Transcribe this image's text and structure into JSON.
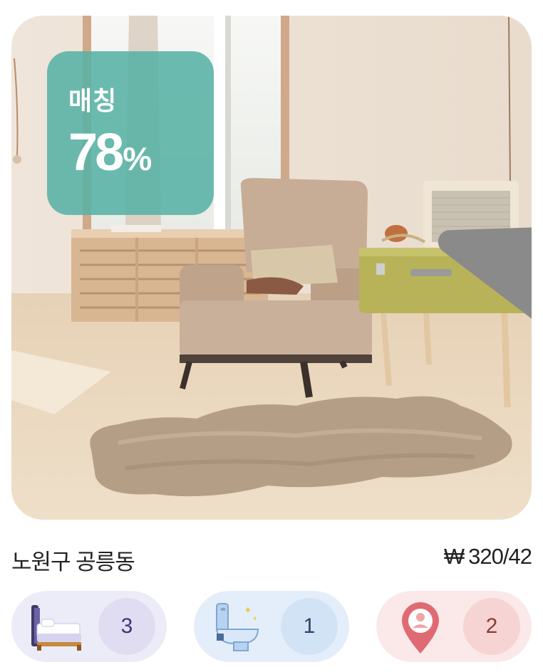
{
  "listing": {
    "match": {
      "label": "매칭",
      "value": "78",
      "unit": "%"
    },
    "favorite_icon": "star-icon",
    "address": "노원구 공릉동",
    "price": {
      "currency": "₩",
      "deposit": "320",
      "separator": "/",
      "monthly": "42"
    }
  },
  "features": [
    {
      "icon": "bed-icon",
      "count": "3"
    },
    {
      "icon": "toilet-icon",
      "count": "1"
    },
    {
      "icon": "location-pin-icon",
      "count": "2"
    }
  ],
  "colors": {
    "match_badge": "#58b2a5",
    "star": "#8a8a8a",
    "bed_pill": "#ecebf8",
    "bath_pill": "#e4eefa",
    "place_pill": "#fbe8e8"
  }
}
